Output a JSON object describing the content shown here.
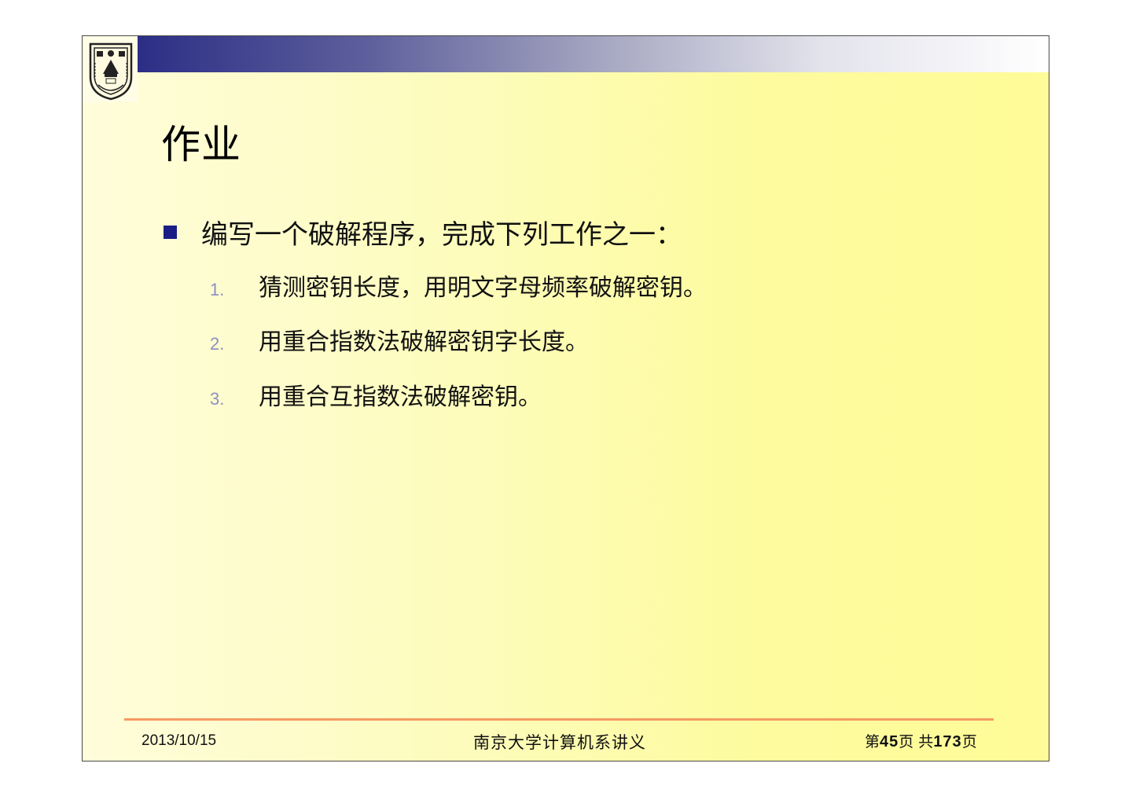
{
  "slide": {
    "title": "作业",
    "bullet": "编写一个破解程序，完成下列工作之一：",
    "items": [
      {
        "num": "1.",
        "text": "猜测密钥长度，用明文字母频率破解密钥。"
      },
      {
        "num": "2.",
        "text": "用重合指数法破解密钥字长度。"
      },
      {
        "num": "3.",
        "text": "用重合互指数法破解密钥。"
      }
    ]
  },
  "footer": {
    "date": "2013/10/15",
    "center": "南京大学计算机系讲义",
    "page_prefix": "第",
    "page_current": "45",
    "page_mid": "页 共",
    "page_total": "173",
    "page_suffix": "页"
  },
  "colors": {
    "bullet": "#1b1d86",
    "number": "#8d8fc2",
    "footer_rule": "#f59a62",
    "bar_start": "#2c2e86"
  },
  "icons": {
    "logo": "nanjing-university-crest"
  }
}
